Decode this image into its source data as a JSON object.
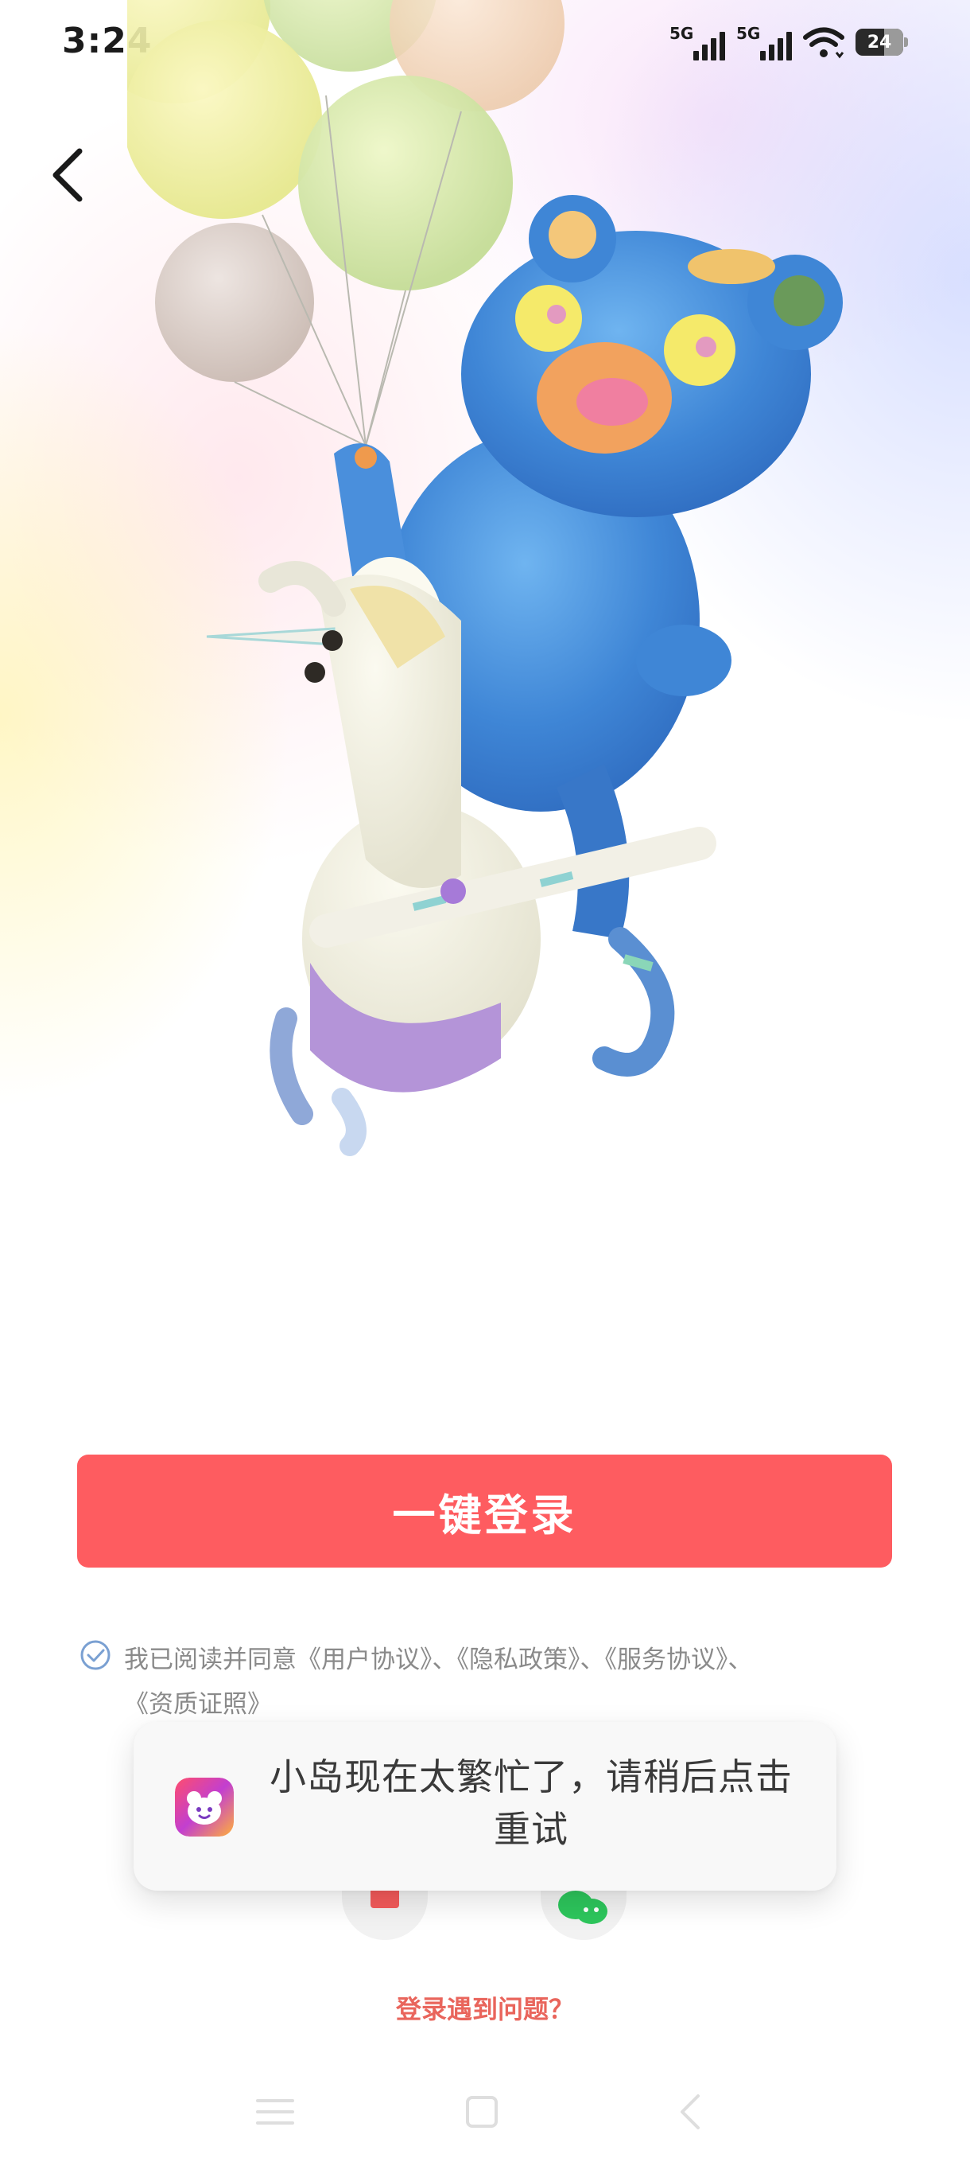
{
  "status_bar": {
    "time": "3:24",
    "signal_1": "5G",
    "signal_2": "5G",
    "battery": "24"
  },
  "login": {
    "one_tap_label": "一键登录"
  },
  "agreement": {
    "prefix": "我已阅读并同意",
    "user_agreement": "《用户协议》",
    "sep1": "、",
    "privacy_policy": "《隐私政策》",
    "sep2": "、",
    "service_agreement": "《服务协议》",
    "sep3": "、",
    "qualification": "《资质证照》"
  },
  "toast": {
    "message": "小岛现在太繁忙了，请稍后点击重试"
  },
  "login_help": "登录遇到问题？",
  "colors": {
    "primary": "#fe5c60",
    "help_link": "#e9655c"
  },
  "icons": {
    "back": "chevron-left-icon",
    "checkbox": "check-circle-icon",
    "wechat": "wechat-icon",
    "phone": "phone-icon",
    "app": "bear-app-icon"
  }
}
